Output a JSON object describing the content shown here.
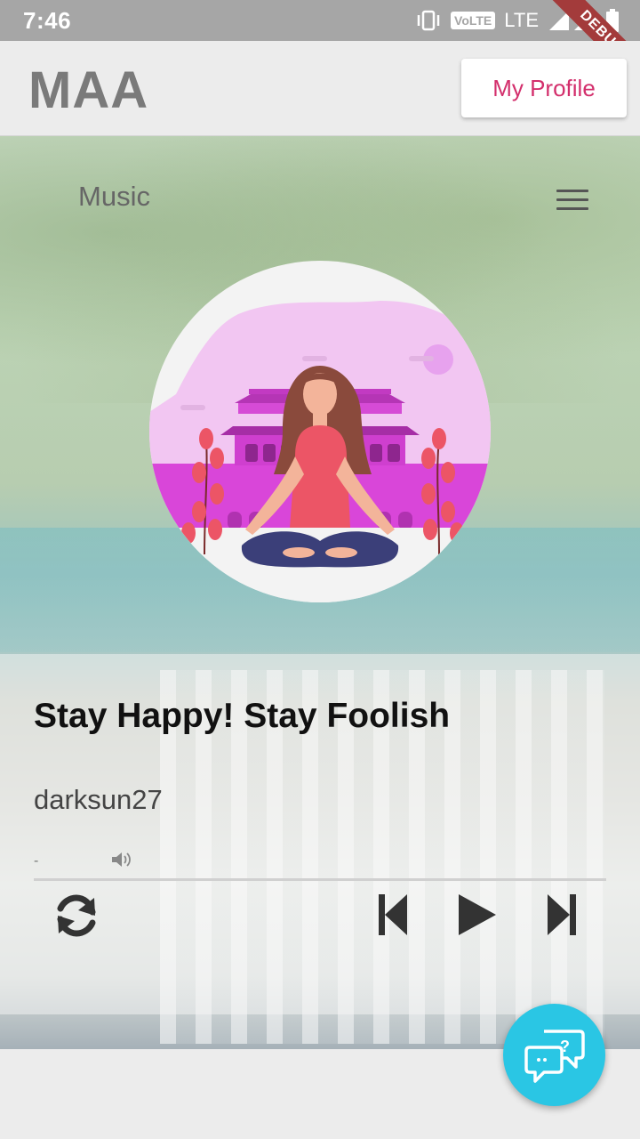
{
  "status_bar": {
    "time": "7:46",
    "volte": "VoLTE",
    "network": "LTE",
    "debug": "DEBUG"
  },
  "app_bar": {
    "title": "MAA",
    "profile_button": "My Profile"
  },
  "header": {
    "section_label": "Music"
  },
  "player": {
    "song_title": "Stay Happy! Stay Foolish",
    "artist": "darksun27",
    "time_text": "-",
    "progress": 0
  },
  "colors": {
    "accent": "#d32f6c",
    "fab": "#2ac6e4",
    "art_pink": "#d946d9"
  },
  "icons": [
    "vibrate-icon",
    "signal-icon",
    "battery-icon",
    "menu-icon",
    "volume-icon",
    "repeat-icon",
    "previous-icon",
    "play-icon",
    "next-icon",
    "help-chat-icon"
  ]
}
